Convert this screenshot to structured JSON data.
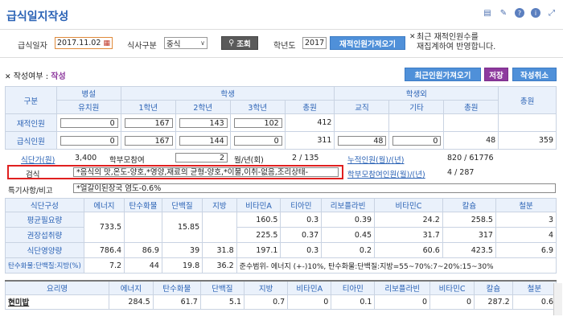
{
  "page": {
    "title": "급식일지작성"
  },
  "filter": {
    "date_label": "급식일자",
    "date_value": "2017.11.02",
    "meal_label": "식사구분",
    "meal_value": "중식",
    "search_label": "조회",
    "year_label": "학년도",
    "year_value": "2017",
    "fetch_label": "재적인원가져오기",
    "note_line1": "최근 재적인원수를",
    "note_line2": "재집계하여 반영합니다."
  },
  "status": {
    "label": "작성여부 :",
    "value": "작성"
  },
  "actions": {
    "recent": "최근인원가져오기",
    "save": "저장",
    "cancel": "작성취소"
  },
  "people": {
    "h_gubun": "구분",
    "h_student": "학생",
    "h_byeol": "병설",
    "h_outside": "학생외",
    "h_total": "총원",
    "h_kinder": "유치원",
    "h_g1": "1학년",
    "h_g2": "2학년",
    "h_g3": "3학년",
    "h_sub_total": "총원",
    "h_staff": "교직",
    "h_etc": "기타",
    "h_sub_total2": "총원",
    "row1": {
      "label": "재적인원",
      "kinder": "0",
      "g1": "167",
      "g2": "143",
      "g3": "102",
      "total": "412"
    },
    "row2": {
      "label": "급식인원",
      "kinder": "0",
      "g1": "167",
      "g2": "144",
      "g3": "0",
      "total": "311",
      "staff": "48",
      "etc": "0",
      "sub": "48",
      "grand": "359"
    }
  },
  "info": {
    "unitprice_label": "식단가(원)",
    "unitprice_value": "3,400",
    "parent_label": "학부모참여",
    "parent_value": "2",
    "month_year_label": "월/년(회)",
    "month_year_value": "2 / 135",
    "cum_label": "누적인원(월)/(년)",
    "cum_value": "820 / 61776",
    "inspect_label": "검식",
    "inspect_value": "*음식의 맛,온도-양호,*영양,재료의 균형-양호,*이물,이취-없음,조리상태-",
    "parent_cum_label": "학부모참여인원(월)/(년)",
    "parent_cum_value": "4 / 287",
    "remarks_label": "특기사항/비고",
    "remarks_value": "*얼갈이된장국 염도-0.6%"
  },
  "nutrition": {
    "headers": [
      "식단구성",
      "에너지",
      "탄수화물",
      "단백질",
      "지방",
      "비타민A",
      "티아민",
      "리보플라빈",
      "비타민C",
      "칼슘",
      "철분"
    ],
    "rows": [
      {
        "label": "평균필요량",
        "energy": "733.5",
        "carb": "",
        "protein": "15.85",
        "fat": "",
        "vita": "160.5",
        "thia": "0.3",
        "ribo": "0.39",
        "vitc": "24.2",
        "ca": "258.5",
        "fe": "3"
      },
      {
        "label": "권장섭취량",
        "energy": "",
        "carb": "",
        "protein": "",
        "fat": "",
        "vita": "225.5",
        "thia": "0.37",
        "ribo": "0.45",
        "vitc": "31.7",
        "ca": "317",
        "fe": "4"
      },
      {
        "label": "식단영양량",
        "energy": "786.4",
        "carb": "86.9",
        "protein": "39",
        "fat": "31.8",
        "vita": "197.1",
        "thia": "0.3",
        "ribo": "0.2",
        "vitc": "60.6",
        "ca": "423.5",
        "fe": "6.9"
      },
      {
        "label": "탄수화물:단백질:지방(%)",
        "energy": "7.2",
        "carb": "44",
        "protein": "19.8",
        "fat": "36.2"
      }
    ],
    "ratio_note": "준수범위- 에너지 (+-)10%, 탄수화물:단백질:지방=55~70%:7~20%:15~30%"
  },
  "dishes": {
    "headers": [
      "요리명",
      "에너지",
      "탄수화물",
      "단백질",
      "지방",
      "비타민A",
      "티아민",
      "리보플라빈",
      "비타민C",
      "칼슘",
      "철분"
    ],
    "rows": [
      {
        "name": "현미밥",
        "energy": "284.5",
        "carb": "61.7",
        "protein": "5.1",
        "fat": "0.7",
        "vita": "0",
        "thia": "0.1",
        "ribo": "0",
        "vitc": "0",
        "ca": "287.2",
        "fe": "0.6"
      }
    ]
  },
  "icons": [
    "list-icon",
    "edit-icon",
    "help-icon",
    "info-icon",
    "expand-icon"
  ]
}
